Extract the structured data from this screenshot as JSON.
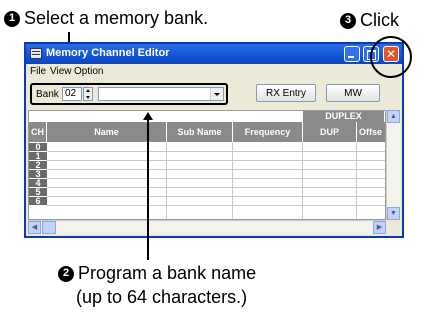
{
  "callouts": {
    "one": {
      "num": "1",
      "text": "Select a memory bank."
    },
    "two": {
      "num": "2",
      "line1": "Program a bank name",
      "line2": "(up to 64 characters.)"
    },
    "three": {
      "num": "3",
      "text": "Click"
    }
  },
  "window": {
    "title": "Memory Channel Editor",
    "close_glyph": "✕"
  },
  "menu": [
    "File",
    "View",
    "Option"
  ],
  "toolbar": {
    "bank_label": "Bank",
    "bank_value": "02",
    "name_value": "",
    "rx_entry": "RX Entry",
    "mw": "MW"
  },
  "table": {
    "group_header": "DUPLEX",
    "columns": [
      "CH",
      "Name",
      "Sub Name",
      "Frequency",
      "DUP",
      "Offse"
    ],
    "rows": [
      "0",
      "1",
      "2",
      "3",
      "4",
      "5",
      "6"
    ]
  },
  "scroll": {
    "up": "▲",
    "down": "▼",
    "left": "◀",
    "right": "▶"
  }
}
